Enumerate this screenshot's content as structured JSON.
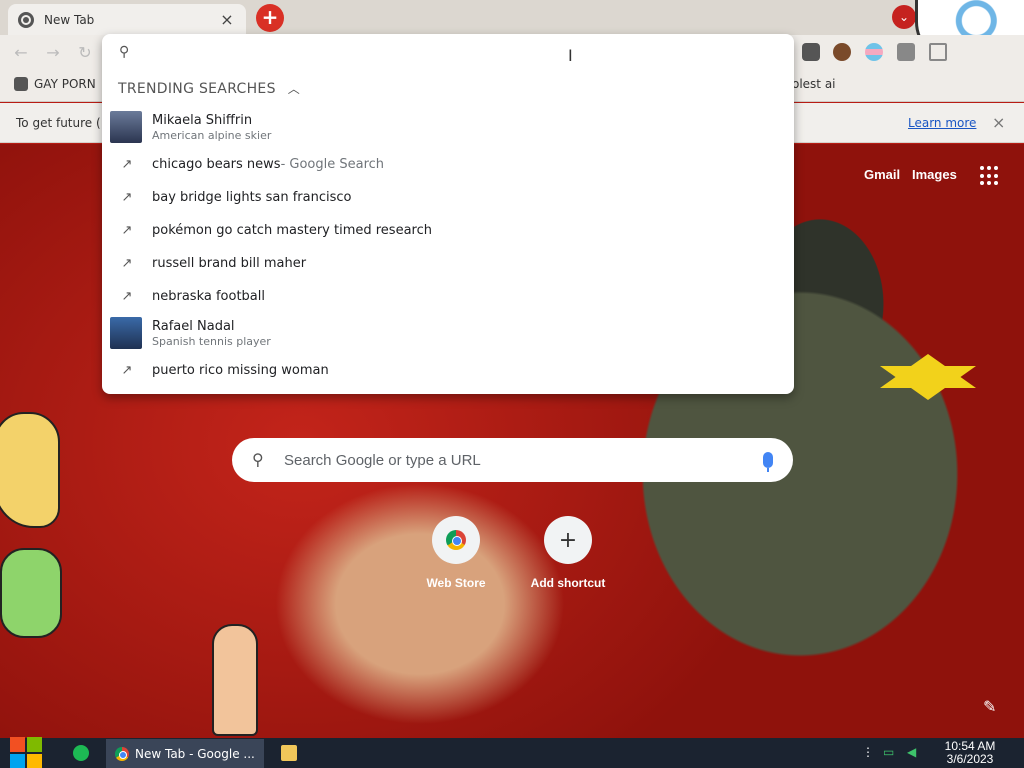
{
  "browser": {
    "tab": {
      "title": "New Tab"
    },
    "bookmarks": {
      "first": "GAY PORN",
      "right": "olest ai"
    },
    "infobar": {
      "message": "To get future (",
      "learn_more": "Learn more"
    }
  },
  "page": {
    "header_links": {
      "gmail": "Gmail",
      "images": "Images"
    },
    "search": {
      "placeholder": "Search Google or type a URL"
    },
    "shortcuts": [
      {
        "label": "Web Store",
        "icon": "chrome-web-store-icon"
      },
      {
        "label": "Add shortcut",
        "icon": "plus-icon"
      }
    ]
  },
  "omnibox_dropdown": {
    "heading": "TRENDING SEARCHES",
    "items": [
      {
        "type": "entity",
        "text": "Mikaela Shiffrin",
        "sub": "American alpine skier"
      },
      {
        "type": "trend",
        "text": "chicago bears news",
        "suffix": " - Google Search"
      },
      {
        "type": "trend",
        "text": "bay bridge lights san francisco"
      },
      {
        "type": "trend",
        "text": "pokémon go catch mastery timed research"
      },
      {
        "type": "trend",
        "text": "russell brand bill maher"
      },
      {
        "type": "trend",
        "text": "nebraska football"
      },
      {
        "type": "entity",
        "text": "Rafael Nadal",
        "sub": "Spanish tennis player"
      },
      {
        "type": "trend",
        "text": "puerto rico missing woman"
      }
    ]
  },
  "taskbar": {
    "active_window": "New Tab - Google ...",
    "time": "10:54 AM",
    "date": "3/6/2023"
  },
  "colors": {
    "page_bg": "#b81c14",
    "new_tab_button": "#d93025",
    "link": "#1a56c4",
    "taskbar": "#1b2330"
  }
}
